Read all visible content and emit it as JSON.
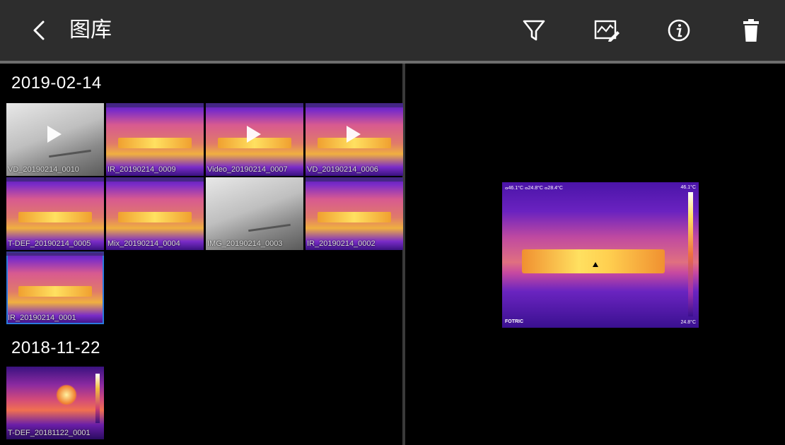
{
  "header": {
    "title": "图库",
    "back_icon": "chevron-left-icon",
    "actions": [
      {
        "name": "filter",
        "icon": "filter-icon"
      },
      {
        "name": "edit-image",
        "icon": "image-edit-icon"
      },
      {
        "name": "info",
        "icon": "info-icon"
      },
      {
        "name": "delete",
        "icon": "trash-icon"
      }
    ]
  },
  "groups": [
    {
      "date": "2019-02-14",
      "items": [
        {
          "caption": "VD_20190214_0010",
          "kind": "visual-video"
        },
        {
          "caption": "IR_20190214_0009",
          "kind": "ir"
        },
        {
          "caption": "Video_20190214_0007",
          "kind": "ir-video"
        },
        {
          "caption": "VD_20190214_0006",
          "kind": "ir-video"
        },
        {
          "caption": "T-DEF_20190214_0005",
          "kind": "ir"
        },
        {
          "caption": "Mix_20190214_0004",
          "kind": "ir"
        },
        {
          "caption": "IMG_20190214_0003",
          "kind": "visual"
        },
        {
          "caption": "IR_20190214_0002",
          "kind": "ir"
        },
        {
          "caption": "IR_20190214_0001",
          "kind": "ir",
          "selected": true
        }
      ]
    },
    {
      "date": "2018-11-22",
      "items": [
        {
          "caption": "T-DEF_20181122_0001",
          "kind": "ir2"
        }
      ]
    }
  ],
  "preview": {
    "readout": "ⴰ46.1°C  ⴰ24.8°C  ⴰ28.4°C",
    "scale_max": "46.1°C",
    "scale_min": "24.8°C",
    "brand": "FOTRIC"
  },
  "colors": {
    "header_bg": "#2d2d2d",
    "selection": "#2b7be0",
    "background": "#000000"
  }
}
